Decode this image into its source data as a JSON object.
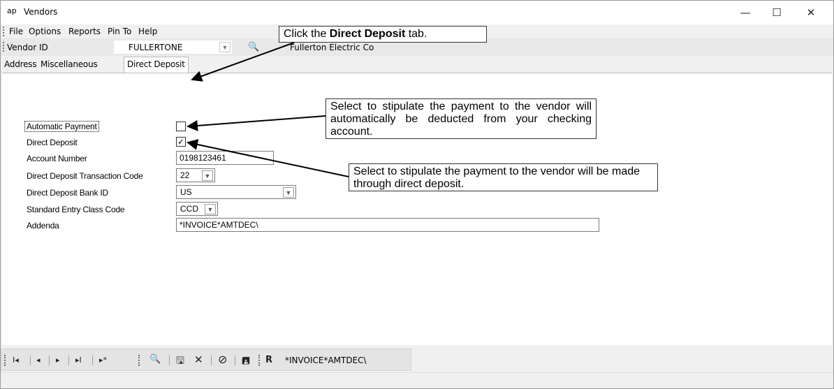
{
  "window": {
    "app_icon_text": "ap",
    "title": "Vendors",
    "minimize": "—",
    "maximize": "☐",
    "close": "✕"
  },
  "menu": {
    "items": [
      "File",
      "Options",
      "Reports",
      "Pin To",
      "Help"
    ]
  },
  "toolbar": {
    "vendor_id_label": "Vendor ID",
    "vendor_id_value": "FULLERTONE",
    "vendor_name": "Fullerton Electric Co"
  },
  "tabs": [
    {
      "label": "Address",
      "active": false
    },
    {
      "label": "Miscellaneous",
      "active": false
    },
    {
      "label": "Direct Deposit",
      "active": true
    }
  ],
  "form": {
    "automatic_payment_label": "Automatic Payment",
    "automatic_payment_checked": false,
    "direct_deposit_label": "Direct Deposit",
    "direct_deposit_checked": true,
    "direct_deposit_check_glyph": "✓",
    "account_number_label": "Account Number",
    "account_number_value": "0198123461",
    "transaction_code_label": "Direct Deposit Transaction Code",
    "transaction_code_value": "22",
    "bank_id_label": "Direct Deposit Bank ID",
    "bank_id_value": "US",
    "sec_code_label": "Standard Entry Class Code",
    "sec_code_value": "CCD",
    "addenda_label": "Addenda",
    "addenda_value": "*INVOICE*AMTDEC\\"
  },
  "callouts": {
    "tab_prefix": "Click the ",
    "tab_bold": "Direct Deposit",
    "tab_suffix": " tab.",
    "automatic_payment": "Select to stipulate the payment to the vendor will automatically be deducted from your checking account.",
    "direct_deposit": "Select to stipulate the payment to the vendor will be made through direct deposit."
  },
  "navbar": {
    "first": "I◂",
    "prev": "◂",
    "next": "▸",
    "last": "▸I",
    "new": "▸*",
    "addenda_display": "*INVOICE*AMTDEC\\"
  },
  "colors": {
    "window_bg": "#f0f0f0",
    "panel_bg": "#ffffff",
    "toolbar_bg": "#e8e8e8"
  }
}
